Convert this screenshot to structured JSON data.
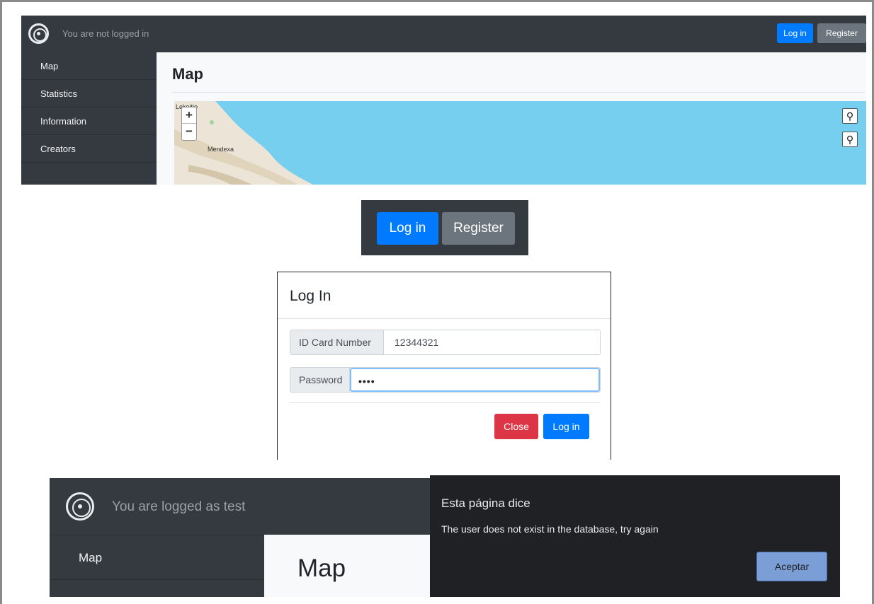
{
  "panel1": {
    "status": "You are not logged in",
    "login_label": "Log in",
    "register_label": "Register",
    "sidebar": [
      "Map",
      "Statistics",
      "Information",
      "Creators"
    ],
    "page_title": "Map",
    "map": {
      "zoom_in": "+",
      "zoom_out": "−",
      "search_glyph": "⚲",
      "place_top": "Lekeitio",
      "place": "Mendexa"
    }
  },
  "panel2": {
    "login_label": "Log in",
    "register_label": "Register"
  },
  "modal": {
    "title": "Log In",
    "id_label": "ID Card Number",
    "id_value": "12344321",
    "password_label": "Password",
    "password_value": "••••",
    "close_label": "Close",
    "login_label": "Log in"
  },
  "panel4": {
    "status": "You are logged as test",
    "sidebar_item": "Map",
    "page_title": "Map"
  },
  "dialog": {
    "title": "Esta página dice",
    "message": "The user does not exist in the database, try again",
    "accept_label": "Aceptar"
  },
  "colors": {
    "navbar": "#343a40",
    "primary": "#007bff",
    "secondary": "#6c757d",
    "danger": "#dc3545",
    "water": "#76cfee"
  }
}
